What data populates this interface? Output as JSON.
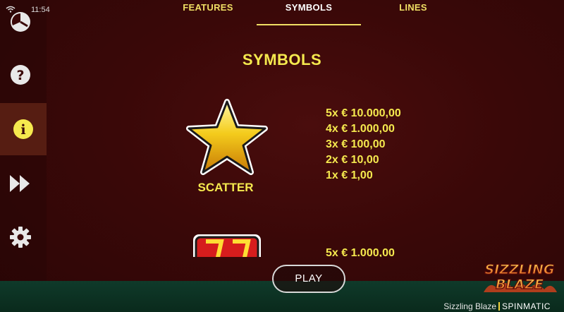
{
  "status": {
    "time": "11:54"
  },
  "sidebar": {
    "items": [
      {
        "icon": "history-icon",
        "active": false
      },
      {
        "icon": "help-icon",
        "active": false
      },
      {
        "icon": "info-icon",
        "active": true
      },
      {
        "icon": "fast-forward-icon",
        "active": false
      },
      {
        "icon": "gear-icon",
        "active": false
      },
      {
        "icon": "close-icon",
        "active": false
      }
    ]
  },
  "tabs": [
    {
      "label": "FEATURES",
      "active": false
    },
    {
      "label": "SYMBOLS",
      "active": true
    },
    {
      "label": "LINES",
      "active": false
    }
  ],
  "main": {
    "heading": "SYMBOLS",
    "scatter": {
      "label": "SCATTER",
      "payouts": [
        "5x € 10.000,00",
        "4x € 1.000,00",
        "3x € 100,00",
        "2x € 10,00",
        "1x € 1,00"
      ]
    },
    "next_symbol_first_payout": "5x € 1.000,00"
  },
  "play_button": {
    "label": "PLAY"
  },
  "logo": {
    "line1": "SIZZLING",
    "line2": "BLAZE"
  },
  "footer": {
    "game_name": "Sizzling Blaze",
    "brand": "SPINMATIC"
  },
  "colors": {
    "accent": "#f5e94e",
    "background": "#3a0808",
    "bottom_bar": "#0f3a2a"
  }
}
